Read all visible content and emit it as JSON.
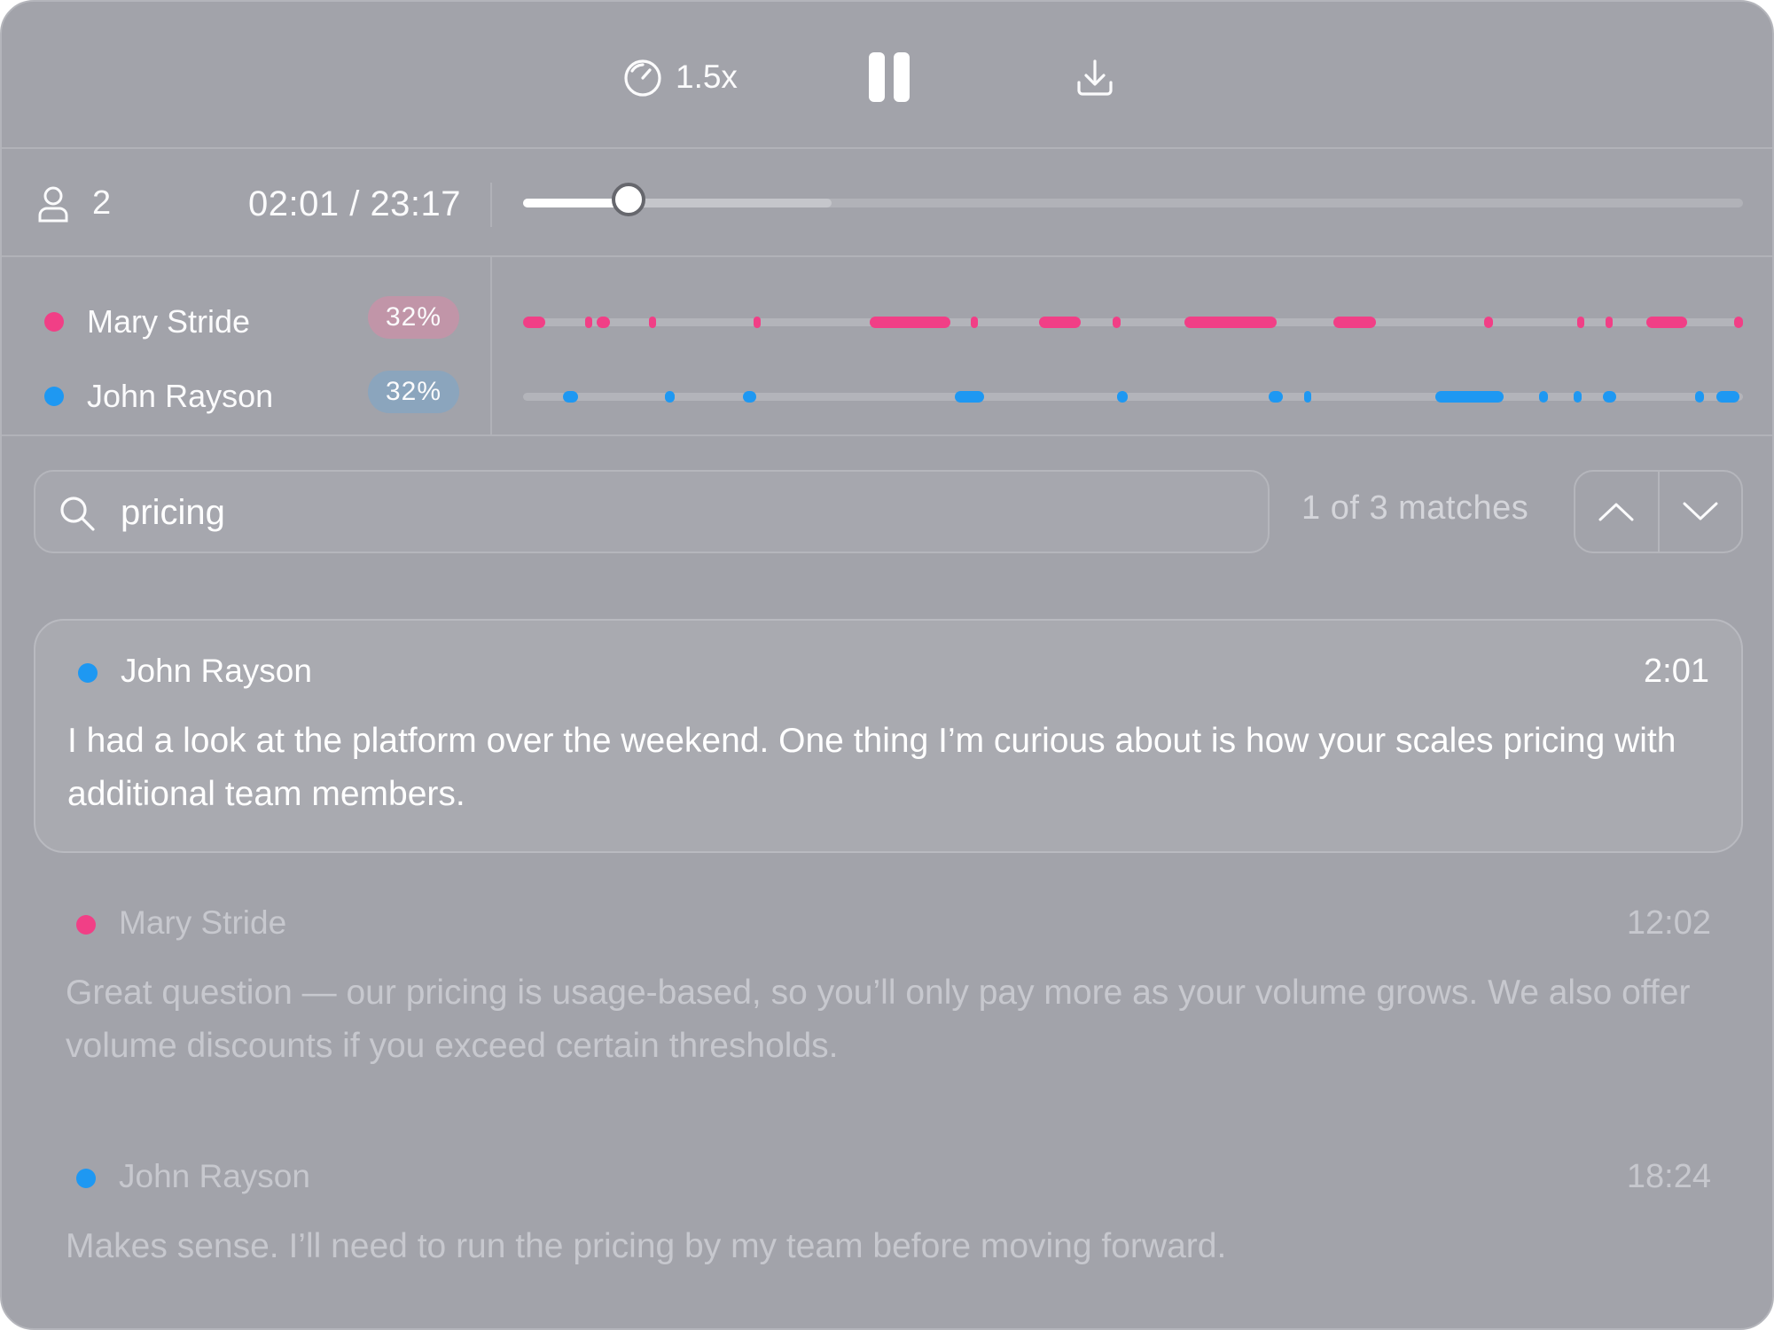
{
  "colors": {
    "mary": "#f13f86",
    "john": "#1e98f2",
    "mary_badge_bg": "#c195a8",
    "john_badge_bg": "#8ba5bd"
  },
  "controls": {
    "speed_icon": "gauge-icon",
    "speed_label": "1.5x",
    "pause_icon": "pause-icon",
    "download_icon": "download-icon"
  },
  "playback": {
    "participants_icon": "user-icon",
    "participants_count": "2",
    "time_label": "02:01 / 23:17",
    "progress_fraction": 0.0868,
    "buffered_fraction": 0.253
  },
  "speakers": [
    {
      "name": "Mary Stride",
      "percent": "32%",
      "color_key": "mary",
      "segments": [
        [
          0.0,
          0.018
        ],
        [
          0.051,
          0.054
        ],
        [
          0.06,
          0.071
        ],
        [
          0.103,
          0.108
        ],
        [
          0.189,
          0.194
        ],
        [
          0.284,
          0.35
        ],
        [
          0.367,
          0.372
        ],
        [
          0.423,
          0.457
        ],
        [
          0.483,
          0.49
        ],
        [
          0.542,
          0.618
        ],
        [
          0.664,
          0.699
        ],
        [
          0.788,
          0.795
        ],
        [
          0.864,
          0.867
        ],
        [
          0.887,
          0.893
        ],
        [
          0.921,
          0.954
        ],
        [
          0.993,
          1.0
        ]
      ]
    },
    {
      "name": "John Rayson",
      "percent": "32%",
      "color_key": "john",
      "segments": [
        [
          0.033,
          0.045
        ],
        [
          0.116,
          0.124
        ],
        [
          0.18,
          0.191
        ],
        [
          0.354,
          0.378
        ],
        [
          0.487,
          0.496
        ],
        [
          0.611,
          0.623
        ],
        [
          0.64,
          0.646
        ],
        [
          0.748,
          0.804
        ],
        [
          0.833,
          0.84
        ],
        [
          0.861,
          0.868
        ],
        [
          0.885,
          0.896
        ],
        [
          0.961,
          0.968
        ],
        [
          0.978,
          0.997
        ]
      ]
    }
  ],
  "search": {
    "icon": "search-icon",
    "query": "pricing",
    "match_label": "1 of 3 matches",
    "prev_icon": "chevron-up-icon",
    "next_icon": "chevron-down-icon"
  },
  "transcript": [
    {
      "speaker": "John Rayson",
      "color_key": "john",
      "time": "2:01",
      "text": "I had a look at the platform over the weekend. One thing I’m curious about is how your scales pricing with additional team members."
    },
    {
      "speaker": "Mary Stride",
      "color_key": "mary",
      "time": "12:02",
      "text": "Great question — our pricing is usage-based, so you’ll only pay more as your volume grows. We also offer volume discounts if you exceed certain thresholds."
    },
    {
      "speaker": "John Rayson",
      "color_key": "john",
      "time": "18:24",
      "text": "Makes sense. I’ll need to run the pricing by my team before moving forward."
    }
  ]
}
